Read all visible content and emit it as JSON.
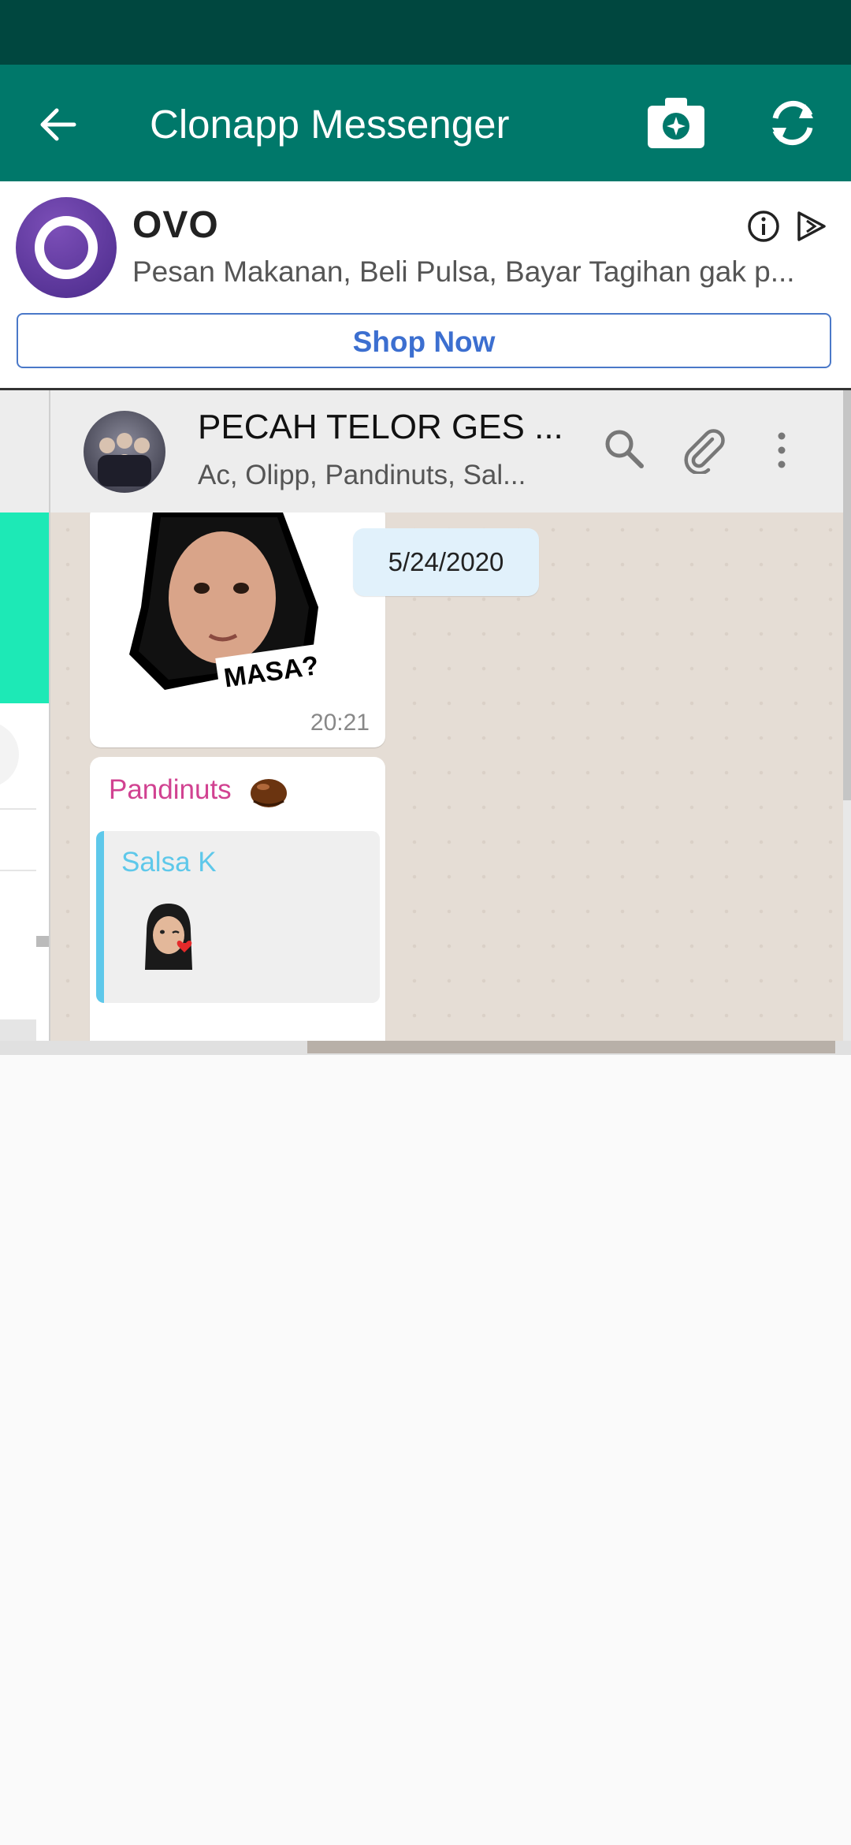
{
  "appbar": {
    "title": "Clonapp Messenger",
    "icons": [
      "back-arrow-icon",
      "camera-icon",
      "sync-icon"
    ]
  },
  "ad": {
    "name": "OVO",
    "description": "Pesan Makanan, Beli Pulsa, Bayar Tagihan gak p...",
    "cta": "Shop Now",
    "icons": [
      "info-icon",
      "ad-choices-icon"
    ]
  },
  "chat": {
    "group_name": "PECAH TELOR GES ...",
    "members": "Ac, Olipp, Pandinuts, Sal...",
    "icons": [
      "search-icon",
      "attach-icon",
      "more-icon"
    ],
    "sticker_text": "MASA?",
    "message1_time": "20:21",
    "date_chip": "5/24/2020",
    "message2": {
      "sender": "Pandinuts",
      "quoted_name": "Salsa K"
    }
  },
  "colors": {
    "statusbar": "#00473f",
    "appbar": "#00786a",
    "shop_now": "#3c6fd0",
    "sender_pink": "#d14291",
    "quote_blue": "#5ec8ea",
    "chat_bg": "#e5ddd5"
  }
}
